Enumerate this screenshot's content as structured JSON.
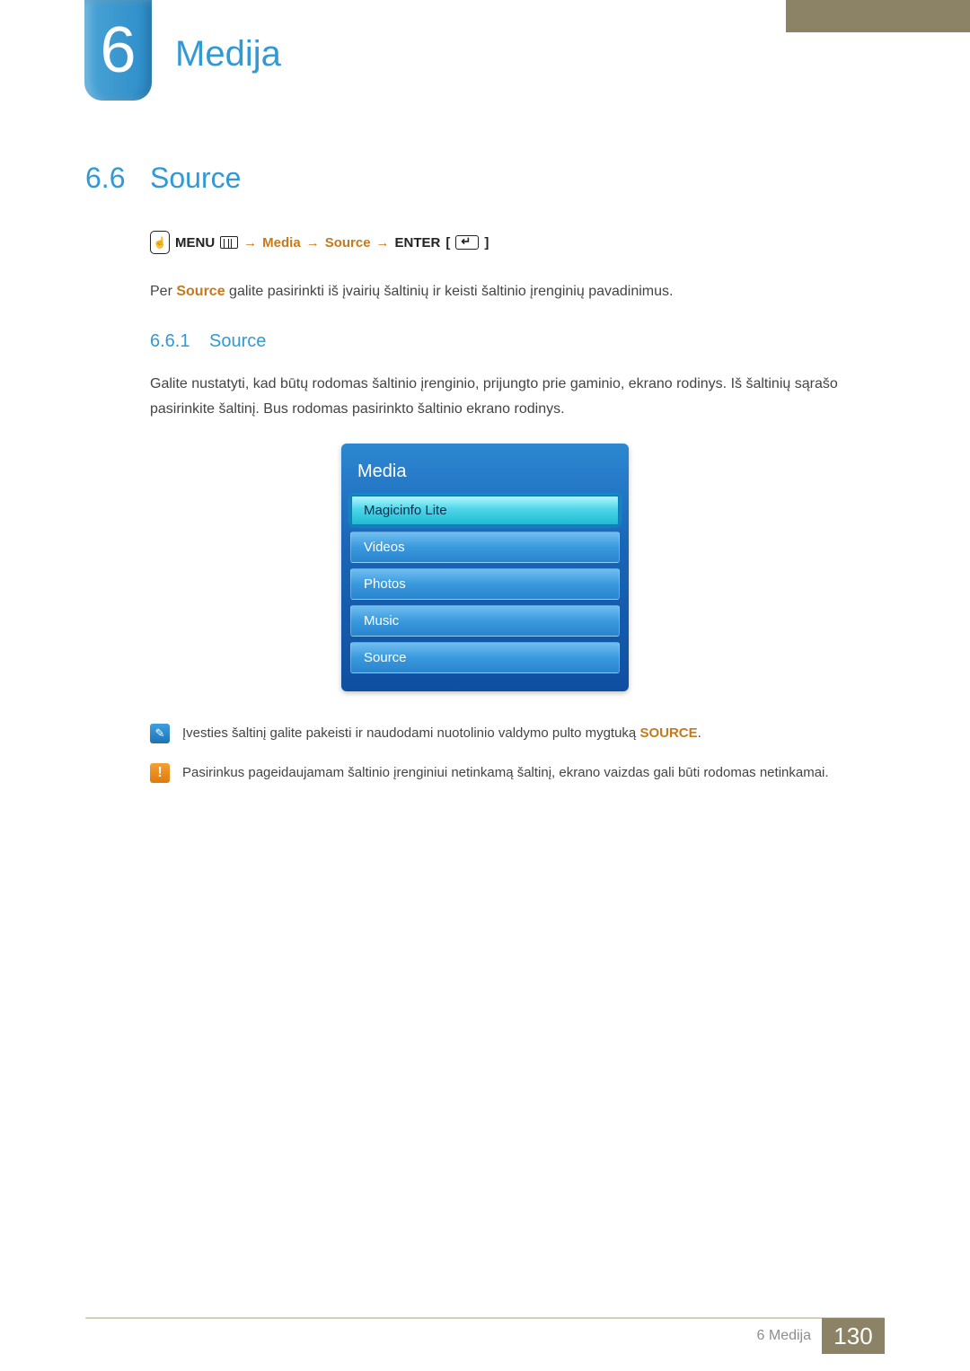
{
  "chapter": {
    "number": "6",
    "title": "Medija"
  },
  "section": {
    "number": "6.6",
    "title": "Source"
  },
  "breadcrumb": {
    "menu": "MENU",
    "path1": "Media",
    "path2": "Source",
    "enter": "ENTER",
    "arrow": "→"
  },
  "intro": {
    "pre": "Per ",
    "hl": "Source",
    "post": " galite pasirinkti iš įvairių šaltinių ir keisti šaltinio įrenginių pavadinimus."
  },
  "subsection": {
    "number": "6.6.1",
    "title": "Source"
  },
  "body": "Galite nustatyti, kad būtų rodomas šaltinio įrenginio, prijungto prie gaminio, ekrano rodinys. Iš šaltinių sąrašo pasirinkite šaltinį. Bus rodomas pasirinkto šaltinio ekrano rodinys.",
  "osd": {
    "title": "Media",
    "items": [
      {
        "label": "Magicinfo Lite",
        "selected": true
      },
      {
        "label": "Videos",
        "selected": false
      },
      {
        "label": "Photos",
        "selected": false
      },
      {
        "label": "Music",
        "selected": false
      },
      {
        "label": "Source",
        "selected": false
      }
    ]
  },
  "note_info": {
    "pre": "Įvesties šaltinį galite pakeisti ir naudodami nuotolinio valdymo pulto mygtuką ",
    "hl": "SOURCE",
    "post": "."
  },
  "note_warn": "Pasirinkus pageidaujamam šaltinio įrenginiui netinkamą šaltinį, ekrano vaizdas gali būti rodomas netinkamai.",
  "footer": {
    "chapter_label": "6 Medija",
    "page": "130"
  }
}
